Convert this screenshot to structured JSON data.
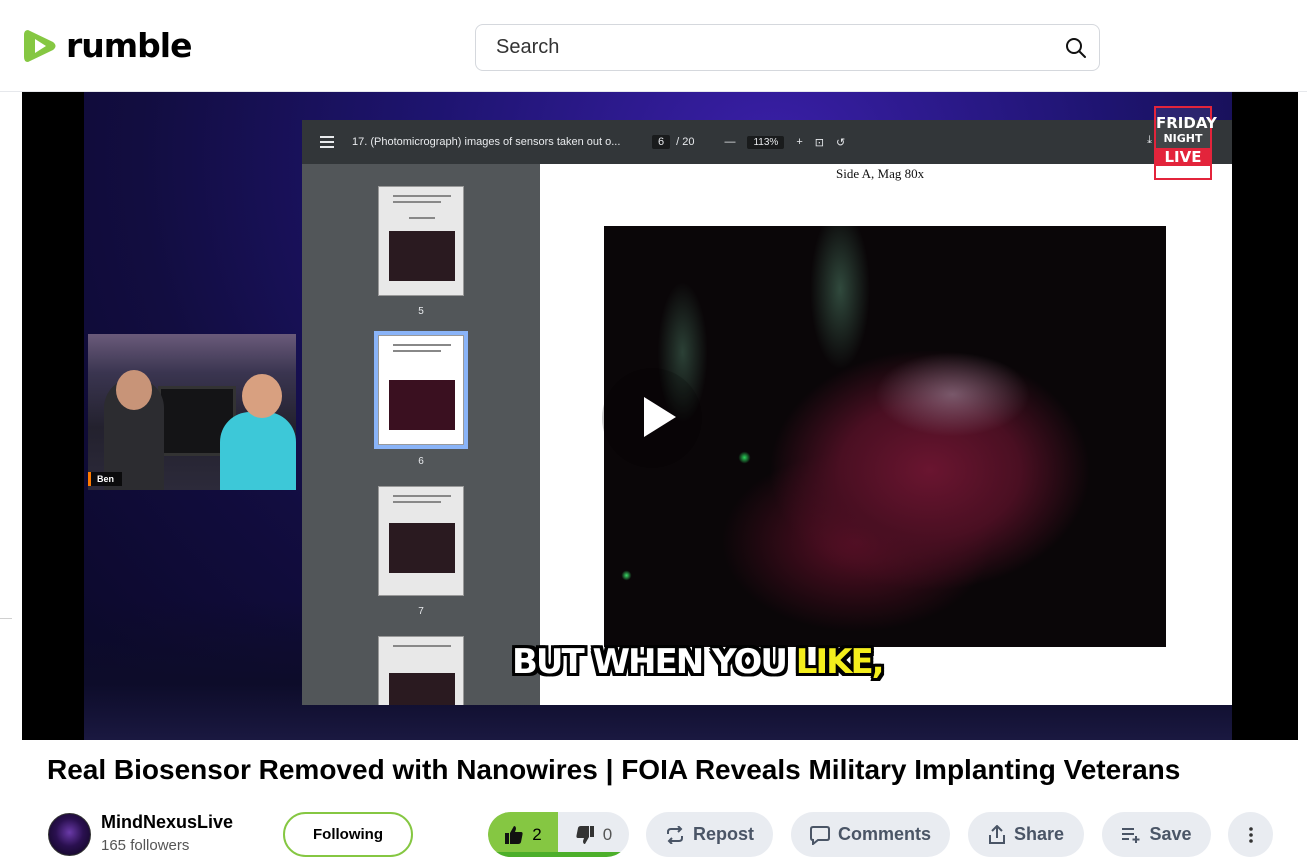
{
  "header": {
    "logo_text": "rumble",
    "search": {
      "placeholder": "Search",
      "value": ""
    }
  },
  "video": {
    "pdf_viewer": {
      "document_title": "17. (Photomicrograph) images of sensors taken out o...",
      "current_page": "6",
      "total_pages": "/ 20",
      "zoom": "113%",
      "page_caption": "Side A, Mag 80x",
      "thumbnails": [
        {
          "label": "5",
          "selected": false
        },
        {
          "label": "6",
          "selected": true
        },
        {
          "label": "7",
          "selected": false
        }
      ]
    },
    "overlay_logo": {
      "line1": "FRIDAY",
      "line2": "NIGHT",
      "line3": "LIVE"
    },
    "camera_name": "Ben",
    "subtitle_before": "BUT WHEN YOU ",
    "subtitle_highlight": "LIKE,"
  },
  "video_title": "Real Biosensor Removed with Nanowires | FOIA Reveals Military Implanting Veterans",
  "channel": {
    "name": "MindNexusLive",
    "followers": "165 followers",
    "follow_button": "Following"
  },
  "actions": {
    "likes": "2",
    "dislikes": "0",
    "like_ratio": 1.0,
    "repost": "Repost",
    "comments": "Comments",
    "share": "Share",
    "save": "Save"
  },
  "colors": {
    "brand_green": "#85c742",
    "pill_bg": "#e9ecf1",
    "subtitle_highlight": "#f4ee1c"
  }
}
